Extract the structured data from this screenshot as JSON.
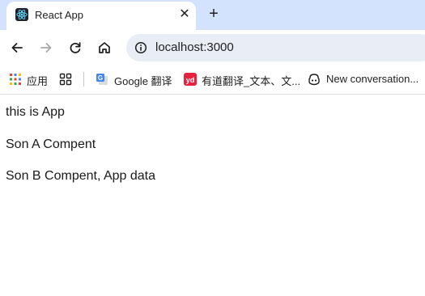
{
  "browser": {
    "tab": {
      "title": "React App",
      "favicon": "react-logo-icon",
      "close_glyph": "✕"
    },
    "new_tab_glyph": "+",
    "address_bar": {
      "url": "localhost:3000",
      "info_icon": "info-icon"
    },
    "nav_icons": [
      "back-arrow-icon",
      "forward-arrow-icon",
      "reload-icon",
      "home-icon"
    ],
    "bookmarks": [
      {
        "label": "应用",
        "icon": "apps-grid-icon"
      },
      {
        "label": "",
        "icon": "tab-groups-icon"
      },
      {
        "label": "Google 翻译",
        "icon": "google-translate-icon"
      },
      {
        "label": "有道翻译_文本、文...",
        "icon": "youdao-icon"
      },
      {
        "label": "New conversation...",
        "icon": "copilot-icon"
      }
    ]
  },
  "page": {
    "lines": [
      "this is App",
      "Son A Compent",
      "Son B Compent, App data"
    ]
  },
  "colors": {
    "tabstrip_bg": "#d3e3fd",
    "omnibox_bg": "#e9eef6",
    "react_blue": "#61dafb",
    "youdao_red": "#e8213e"
  }
}
